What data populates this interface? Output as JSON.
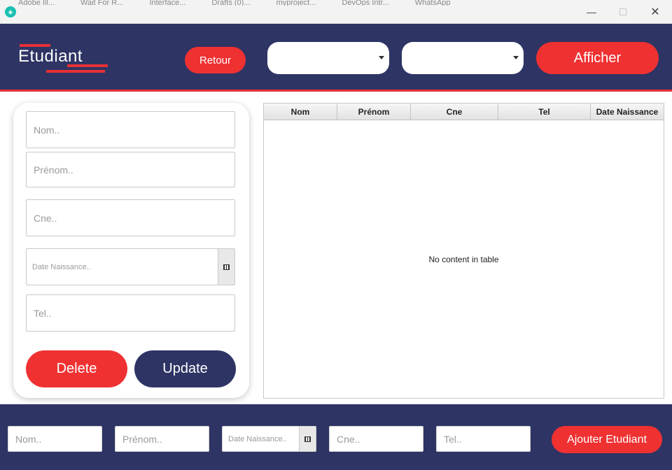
{
  "titlebar": {
    "background_tabs": [
      "Adobe Ill...",
      "Wait For R...",
      "Interface...",
      "Drafts (0)...",
      "myproject...",
      "DevOps Intr...",
      "WhatsApp"
    ],
    "minimize": "—",
    "maximize": "☐",
    "close": "✕"
  },
  "header": {
    "logo_text": "Etudiant",
    "back_label": "Retour",
    "filter1_value": "",
    "filter2_value": "",
    "show_label": "Afficher"
  },
  "form": {
    "nom_placeholder": "Nom..",
    "prenom_placeholder": "Prénom..",
    "cne_placeholder": "Cne..",
    "date_placeholder": "Date Naissance..",
    "tel_placeholder": "Tel..",
    "delete_label": "Delete",
    "update_label": "Update"
  },
  "table": {
    "columns": [
      "Nom",
      "Prénom",
      "Cne",
      "Tel",
      "Date Naissance"
    ],
    "rows": [],
    "empty_text": "No content in table"
  },
  "footer": {
    "nom_placeholder": "Nom..",
    "prenom_placeholder": "Prénom..",
    "date_placeholder": "Date Naissance..",
    "cne_placeholder": "Cne..",
    "tel_placeholder": "Tel..",
    "add_label": "Ajouter Etudiant"
  },
  "colors": {
    "navy": "#2e3464",
    "accent_red": "#ef3132",
    "background": "#ffffff"
  },
  "icons": [
    "app-icon",
    "dropdown-arrow-icon",
    "calendar-icon"
  ]
}
